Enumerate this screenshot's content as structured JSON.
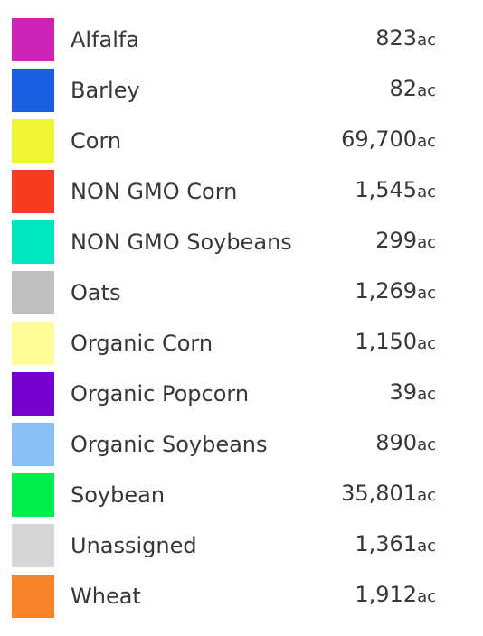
{
  "legend": {
    "unit": "ac",
    "items": [
      {
        "label": "Alfalfa",
        "value": "823",
        "color": "#cc22b5"
      },
      {
        "label": "Barley",
        "value": "82",
        "color": "#1a5fe0"
      },
      {
        "label": "Corn",
        "value": "69,700",
        "color": "#eef532"
      },
      {
        "label": "NON GMO Corn",
        "value": "1,545",
        "color": "#f53b22"
      },
      {
        "label": "NON GMO Soybeans",
        "value": "299",
        "color": "#00e6c0"
      },
      {
        "label": "Oats",
        "value": "1,269",
        "color": "#c0c0c0"
      },
      {
        "label": "Organic Corn",
        "value": "1,150",
        "color": "#fdfd96"
      },
      {
        "label": "Organic Popcorn",
        "value": "39",
        "color": "#7700cc"
      },
      {
        "label": "Organic Soybeans",
        "value": "890",
        "color": "#89c0f8"
      },
      {
        "label": "Soybean",
        "value": "35,801",
        "color": "#00ee4a"
      },
      {
        "label": "Unassigned",
        "value": "1,361",
        "color": "#d6d6d6"
      },
      {
        "label": "Wheat",
        "value": "1,912",
        "color": "#f7822a"
      }
    ]
  }
}
